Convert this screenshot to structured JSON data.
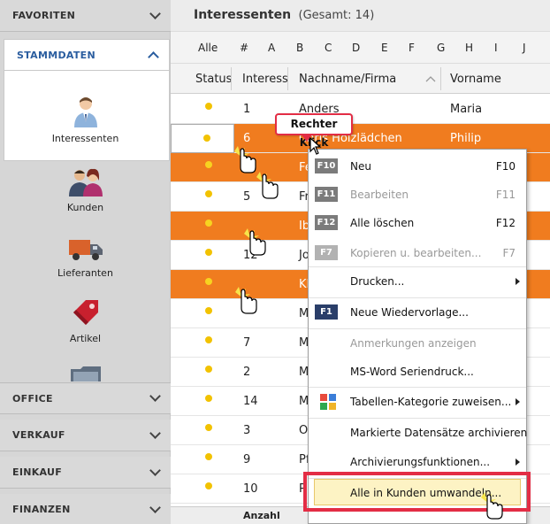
{
  "sidebar": {
    "favoriten": "FAVORITEN",
    "stammdaten": "STAMMDATEN",
    "items": [
      {
        "label": "Interessenten",
        "icon": "person-tie-icon"
      },
      {
        "label": "Kunden",
        "icon": "people-icon"
      },
      {
        "label": "Lieferanten",
        "icon": "truck-icon"
      },
      {
        "label": "Artikel",
        "icon": "price-tag-icon"
      }
    ],
    "bottom_sections": [
      "OFFICE",
      "VERKAUF",
      "EINKAUF",
      "FINANZEN"
    ]
  },
  "list": {
    "title": "Interessenten",
    "total": "(Gesamt: 14)",
    "alpha_filter": [
      "Alle",
      "#",
      "A",
      "B",
      "C",
      "D",
      "E",
      "F",
      "G",
      "H",
      "I",
      "J"
    ],
    "columns": [
      "Status",
      "Interess",
      "Nachname/Firma",
      "Vorname"
    ],
    "rows": [
      {
        "id": "1",
        "name": "Anders",
        "vorname": "Maria",
        "selected": false
      },
      {
        "id": "6",
        "name": "Chris Holzlädchen",
        "vorname": "Philip",
        "selected": true
      },
      {
        "id": "",
        "name": "Fe",
        "vorname": "",
        "selected": true
      },
      {
        "id": "5",
        "name": "Fra",
        "vorname": "",
        "selected": false
      },
      {
        "id": "",
        "name": "Ibs",
        "vorname": "",
        "selected": true
      },
      {
        "id": "12",
        "name": "Jo",
        "vorname": "",
        "selected": false
      },
      {
        "id": "",
        "name": "Kl",
        "vorname": "",
        "selected": true
      },
      {
        "id": "",
        "name": "M",
        "vorname": "",
        "selected": false
      },
      {
        "id": "7",
        "name": "M",
        "vorname": "",
        "selected": false
      },
      {
        "id": "2",
        "name": "M",
        "vorname": "",
        "selected": false
      },
      {
        "id": "14",
        "name": "M",
        "vorname": "",
        "selected": false
      },
      {
        "id": "3",
        "name": "Ot",
        "vorname": "",
        "selected": false
      },
      {
        "id": "9",
        "name": "Pf",
        "vorname": "",
        "selected": false
      },
      {
        "id": "10",
        "name": "P",
        "vorname": "",
        "selected": false
      }
    ],
    "footer": "Anzahl"
  },
  "callout": "Rechter Klick",
  "context_menu": [
    {
      "badge": "F10",
      "label": "Neu",
      "shortcut": "F10",
      "disabled": false
    },
    {
      "badge": "F11",
      "label": "Bearbeiten",
      "shortcut": "F11",
      "disabled": true
    },
    {
      "badge": "F12",
      "label": "Alle löschen",
      "shortcut": "F12",
      "disabled": false
    },
    {
      "badge": "F7",
      "label": "Kopieren u. bearbeiten...",
      "shortcut": "F7",
      "disabled": true
    },
    {
      "badge": "",
      "label": "Drucken...",
      "shortcut": "",
      "disabled": false,
      "submenu": true
    },
    {
      "badge": "F1",
      "label": "Neue Wiedervorlage...",
      "shortcut": "",
      "disabled": false
    },
    {
      "badge": "",
      "label": "Anmerkungen anzeigen",
      "shortcut": "",
      "disabled": true
    },
    {
      "badge": "",
      "label": "MS-Word Seriendruck...",
      "shortcut": "",
      "disabled": false
    },
    {
      "badge": "",
      "label": "Tabellen-Kategorie zuweisen...",
      "shortcut": "",
      "disabled": false,
      "submenu": true
    },
    {
      "badge": "",
      "label": "Markierte Datensätze archivieren",
      "shortcut": "",
      "disabled": false
    },
    {
      "badge": "",
      "label": "Archivierungsfunktionen...",
      "shortcut": "",
      "disabled": false,
      "submenu": true
    },
    {
      "badge": "",
      "label": "Alle in Kunden umwandeln...",
      "shortcut": "",
      "disabled": false,
      "highlighted": true
    }
  ],
  "colors": {
    "selected_row": "#f07c1f",
    "status_dot": "#f2c200",
    "callout_border": "#e32d45",
    "highlight": "#fdf3c4",
    "stammdaten_blue": "#2a5d9f"
  }
}
